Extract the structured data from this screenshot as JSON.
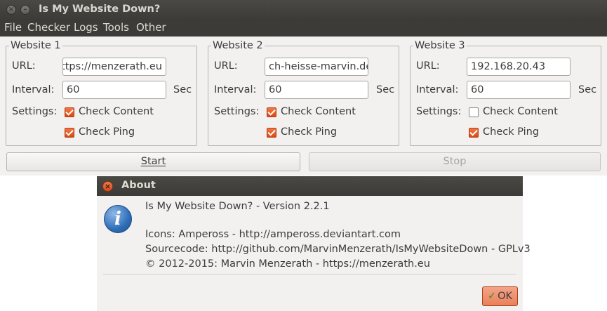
{
  "window": {
    "title": "Is My Website Down?"
  },
  "menu": [
    "File",
    "Checker",
    "Logs",
    "Tools",
    "Other"
  ],
  "websites": [
    {
      "title": "Website 1",
      "url_label": "URL:",
      "url_value": "https://menzerath.eu",
      "interval_label": "Interval:",
      "interval_value": "60",
      "sec_label": "Sec",
      "settings_label": "Settings:",
      "check_content_label": "Check Content",
      "check_content": true,
      "check_ping_label": "Check Ping",
      "check_ping": true
    },
    {
      "title": "Website 2",
      "url_label": "URL:",
      "url_value": "ch-heisse-marvin.de",
      "interval_label": "Interval:",
      "interval_value": "60",
      "sec_label": "Sec",
      "settings_label": "Settings:",
      "check_content_label": "Check Content",
      "check_content": true,
      "check_ping_label": "Check Ping",
      "check_ping": true
    },
    {
      "title": "Website 3",
      "url_label": "URL:",
      "url_value": "192.168.20.43",
      "interval_label": "Interval:",
      "interval_value": "60",
      "sec_label": "Sec",
      "settings_label": "Settings:",
      "check_content_label": "Check Content",
      "check_content": false,
      "check_ping_label": "Check Ping",
      "check_ping": true
    }
  ],
  "buttons": {
    "start": "Start",
    "stop": "Stop"
  },
  "about": {
    "title": "About",
    "version": "Is My Website Down? - Version 2.2.1",
    "icons": "Icons: Ampeross - http://ampeross.deviantart.com",
    "sourcecode": "Sourcecode: http://github.com/MarvinMenzerath/IsMyWebsiteDown - GPLv3",
    "copyright": "© 2012-2015: Marvin Menzerath - https://menzerath.eu",
    "ok": "OK"
  },
  "colors": {
    "accent": "#dd4814",
    "titlebar": "#3c3b37",
    "window_bg": "#f2f1f0"
  }
}
